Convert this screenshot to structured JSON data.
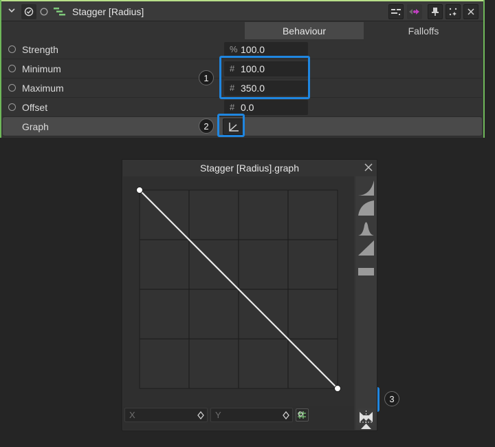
{
  "panel": {
    "title": "Stagger [Radius]",
    "tabs": [
      "Behaviour",
      "Falloffs"
    ],
    "rows": [
      {
        "label": "Strength",
        "unit": "%",
        "value": "100.0"
      },
      {
        "label": "Minimum",
        "unit": "#",
        "value": "100.0"
      },
      {
        "label": "Maximum",
        "unit": "#",
        "value": "350.0"
      },
      {
        "label": "Offset",
        "unit": "#",
        "value": "0.0"
      },
      {
        "label": "Graph"
      }
    ]
  },
  "graph_window": {
    "title": "Stagger [Radius].graph",
    "x_placeholder": "X",
    "y_placeholder": "Y",
    "curve": {
      "start": [
        0,
        1
      ],
      "end": [
        1,
        0
      ]
    }
  },
  "callouts": [
    "1",
    "2",
    "3"
  ],
  "colors": {
    "accent": "#1f86e0",
    "header_accent": "#b9e08a",
    "panel_border": "#6fb85a",
    "key_arrow": "#c040c0",
    "icon_green": "#7fc97a"
  },
  "icons": [
    "chevron-down-icon",
    "check-circle-icon",
    "radio-icon",
    "stagger-icon",
    "sort-icon",
    "keyframe-nav-icon",
    "pin-icon",
    "spark-icon",
    "close-icon",
    "graph-icon",
    "flip-horizontal-icon",
    "flip-vertical-icon",
    "grid-snap-icon"
  ]
}
